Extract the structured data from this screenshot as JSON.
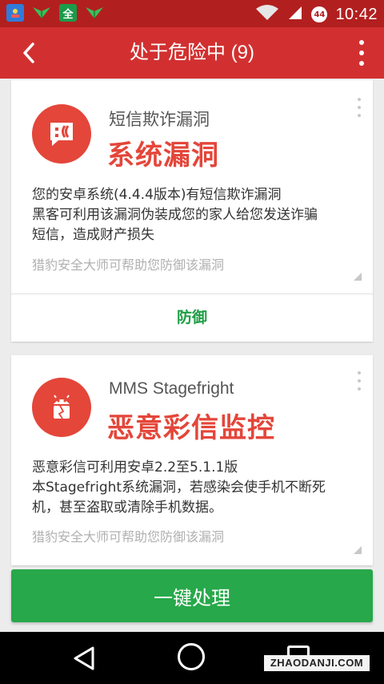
{
  "status_bar": {
    "time": "10:42",
    "battery_level": "44",
    "app_icons": [
      "contacts-app-icon",
      "bird-notification-icon",
      "quanmin-app-icon",
      "bird-notification-icon"
    ],
    "app_icon_glyph": "全"
  },
  "app_bar": {
    "title": "处于危险中 (9)",
    "back_icon": "chevron-left-icon",
    "menu_icon": "more-vertical-icon",
    "color": "#d23030"
  },
  "cards": [
    {
      "icon": "sms-warning-icon",
      "subtitle": "短信欺诈漏洞",
      "title": "系统漏洞",
      "description": [
        "您的安卓系统(4.4.4版本)有短信欺诈漏洞",
        "黑客可利用该漏洞伪装成您的家人给您发送诈骗",
        "短信，造成财产损失"
      ],
      "footnote": "猎豹安全大师可帮助您防御该漏洞",
      "action_label": "防御"
    },
    {
      "icon": "android-broken-icon",
      "subtitle": "MMS Stagefright",
      "title": "恶意彩信监控",
      "description": [
        "恶意彩信可利用安卓2.2至5.1.1版",
        "本Stagefright系统漏洞，若感染会使手机不断死",
        "机，甚至盗取或清除手机数据。"
      ],
      "footnote": "猎豹安全大师可帮助您防御该漏洞"
    }
  ],
  "primary_action": {
    "label": "一键处理",
    "color": "#27a84a"
  },
  "nav_bar": {
    "icons": [
      "back-triangle-icon",
      "home-circle-icon",
      "recents-square-icon"
    ]
  },
  "watermark": "ZHAODANJI.COM",
  "colors": {
    "danger": "#e4463a",
    "status_bar": "#b21f1f",
    "action_green": "#1e9e45"
  }
}
